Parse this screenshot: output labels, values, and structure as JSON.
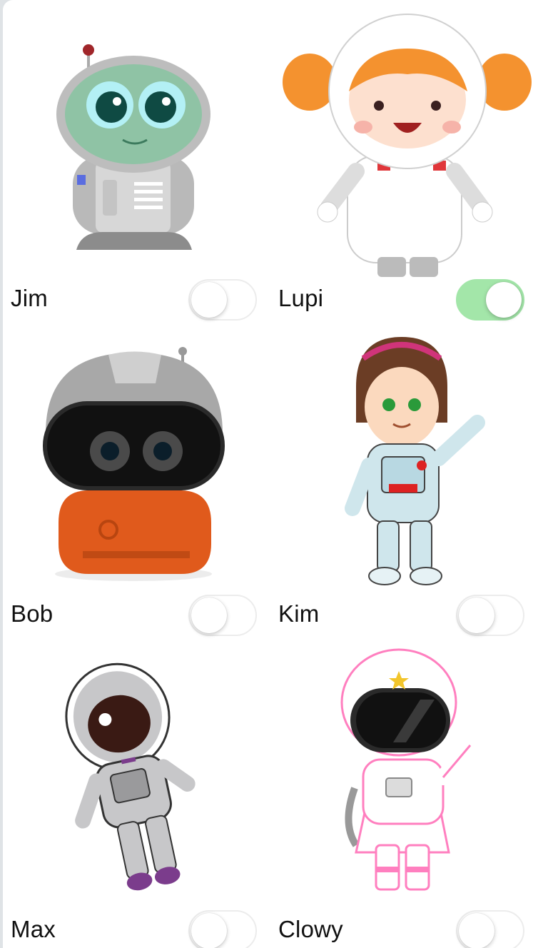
{
  "characters": [
    {
      "name": "Jim",
      "enabled": false
    },
    {
      "name": "Lupi",
      "enabled": true
    },
    {
      "name": "Bob",
      "enabled": false
    },
    {
      "name": "Kim",
      "enabled": false
    },
    {
      "name": "Max",
      "enabled": false
    },
    {
      "name": "Clowy",
      "enabled": false
    }
  ],
  "colors": {
    "toggle_on": "#a3e6a9",
    "toggle_off": "#ffffff"
  },
  "icons": [
    "alien-astronaut-icon",
    "girl-astronaut-icon",
    "robot-astronaut-icon",
    "waving-girl-astronaut-icon",
    "sticker-astronaut-icon",
    "pink-astronaut-icon"
  ]
}
